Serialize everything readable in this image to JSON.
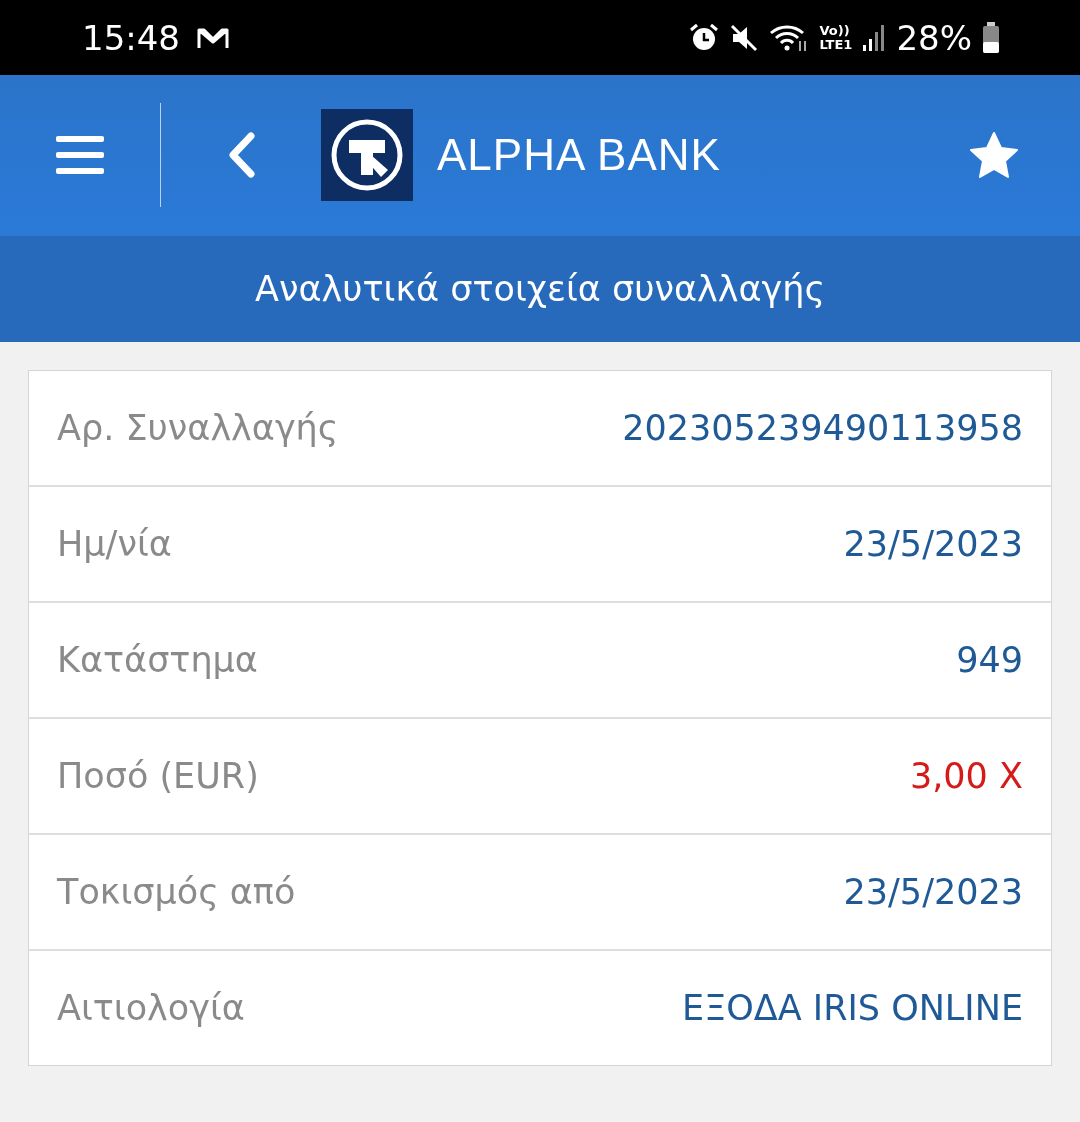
{
  "status_bar": {
    "time": "15:48",
    "volte": "Vo))",
    "network": "LTE1",
    "battery": "28%"
  },
  "header": {
    "logo_text": "ALPHA BANK"
  },
  "page_title": "Αναλυτικά στοιχεία συναλλαγής",
  "details": [
    {
      "label": "Αρ. Συναλλαγής",
      "value": "202305239490113958",
      "kind": "text"
    },
    {
      "label": "Ημ/νία",
      "value": "23/5/2023",
      "kind": "text"
    },
    {
      "label": "Κατάστημα",
      "value": "949",
      "kind": "text"
    },
    {
      "label": "Ποσό (EUR)",
      "value": "3,00 Χ",
      "kind": "debit"
    },
    {
      "label": "Τοκισμός από",
      "value": "23/5/2023",
      "kind": "text"
    },
    {
      "label": "Αιτιολογία",
      "value": "ΕΞΟΔΑ IRIS ONLINE",
      "kind": "text"
    }
  ]
}
